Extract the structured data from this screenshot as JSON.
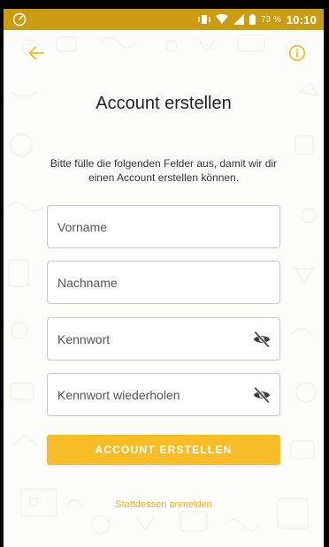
{
  "status_bar": {
    "battery_percent": "73 %",
    "time": "10:10"
  },
  "header": {
    "title": "Account erstellen",
    "subtitle": "Bitte fülle die folgenden Felder aus, damit wir dir einen Account erstellen können."
  },
  "form": {
    "first_name": {
      "placeholder": "Vorname",
      "value": ""
    },
    "last_name": {
      "placeholder": "Nachname",
      "value": ""
    },
    "password": {
      "placeholder": "Kennwort",
      "value": ""
    },
    "password_repeat": {
      "placeholder": "Kennwort wiederholen",
      "value": ""
    }
  },
  "actions": {
    "create_account_label": "ACCOUNT ERSTELLEN",
    "login_instead_label": "Stattdessen anmelden"
  },
  "colors": {
    "accent": "#f6bd27",
    "status_bar": "#c99c12",
    "link": "#e6b021"
  },
  "icons": {
    "back": "arrow-left-icon",
    "info": "info-icon",
    "password_visibility": "eye-off-icon"
  }
}
